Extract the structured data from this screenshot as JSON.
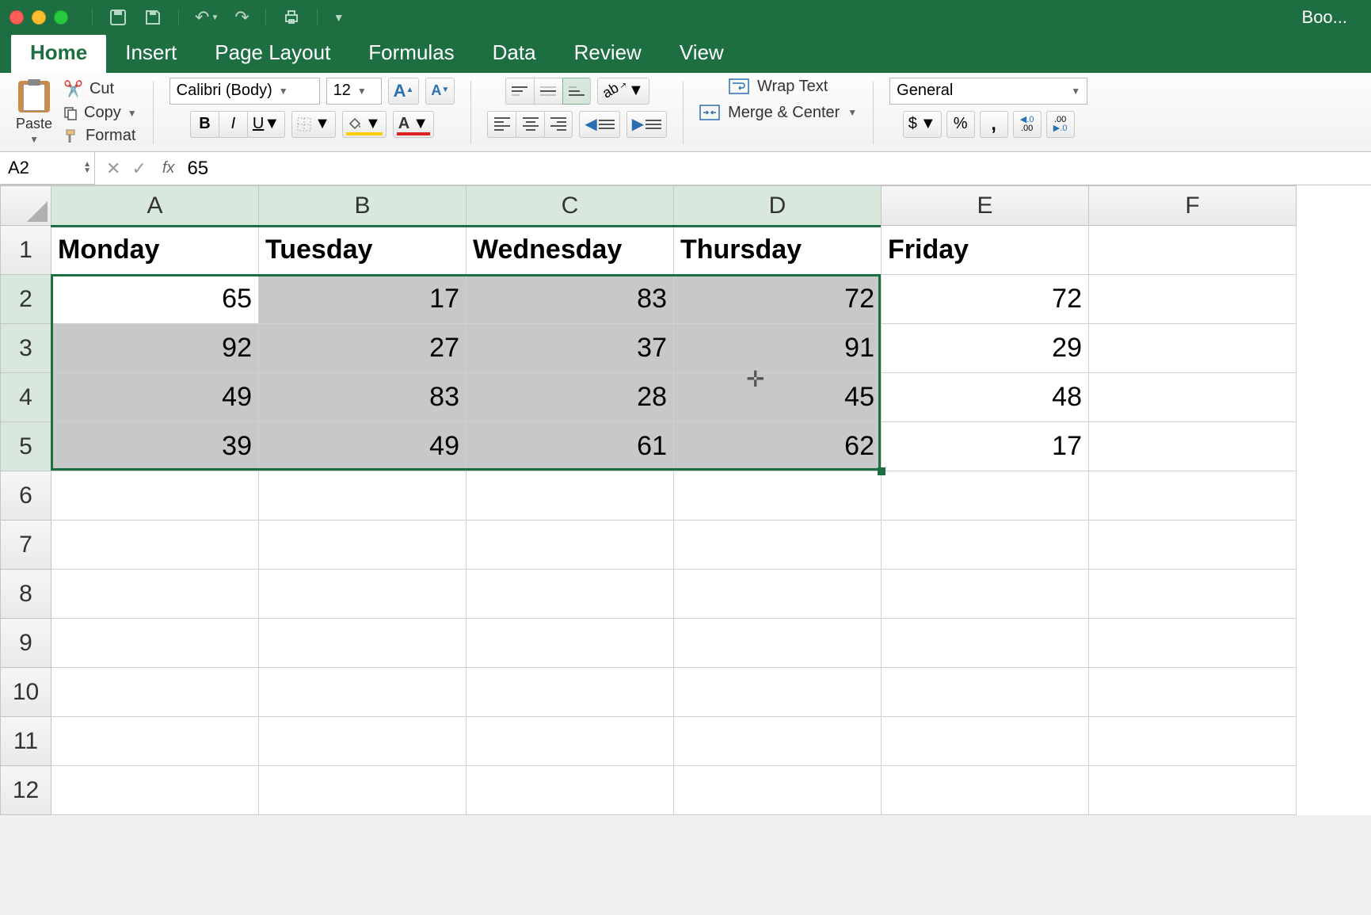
{
  "window": {
    "title": "Boo..."
  },
  "tabs": {
    "home": "Home",
    "insert": "Insert",
    "page_layout": "Page Layout",
    "formulas": "Formulas",
    "data": "Data",
    "review": "Review",
    "view": "View"
  },
  "ribbon": {
    "paste": "Paste",
    "cut": "Cut",
    "copy": "Copy",
    "format": "Format",
    "font_name": "Calibri (Body)",
    "font_size": "12",
    "wrap_text": "Wrap Text",
    "merge_center": "Merge & Center",
    "number_format": "General",
    "currency": "$",
    "percent": "%",
    "comma": "❩",
    "inc_dec_label": ".0",
    "inc_dec_sub": ".00"
  },
  "formula_bar": {
    "name_box": "A2",
    "formula": "65"
  },
  "sheet": {
    "columns": [
      "A",
      "B",
      "C",
      "D",
      "E",
      "F"
    ],
    "row_numbers": [
      1,
      2,
      3,
      4,
      5,
      6,
      7,
      8,
      9,
      10,
      11,
      12
    ],
    "headers": [
      "Monday",
      "Tuesday",
      "Wednesday",
      "Thursday",
      "Friday"
    ],
    "data": [
      [
        65,
        17,
        83,
        72,
        72
      ],
      [
        92,
        27,
        37,
        91,
        29
      ],
      [
        49,
        83,
        28,
        45,
        48
      ],
      [
        39,
        49,
        61,
        62,
        17
      ]
    ],
    "selection": {
      "active": "A2",
      "range": "A2:D5",
      "cursor_at": "D4"
    }
  },
  "chart_data": {
    "type": "table",
    "columns": [
      "Monday",
      "Tuesday",
      "Wednesday",
      "Thursday",
      "Friday"
    ],
    "rows": [
      [
        65,
        17,
        83,
        72,
        72
      ],
      [
        92,
        27,
        37,
        91,
        29
      ],
      [
        49,
        83,
        28,
        45,
        48
      ],
      [
        39,
        49,
        61,
        62,
        17
      ]
    ]
  }
}
